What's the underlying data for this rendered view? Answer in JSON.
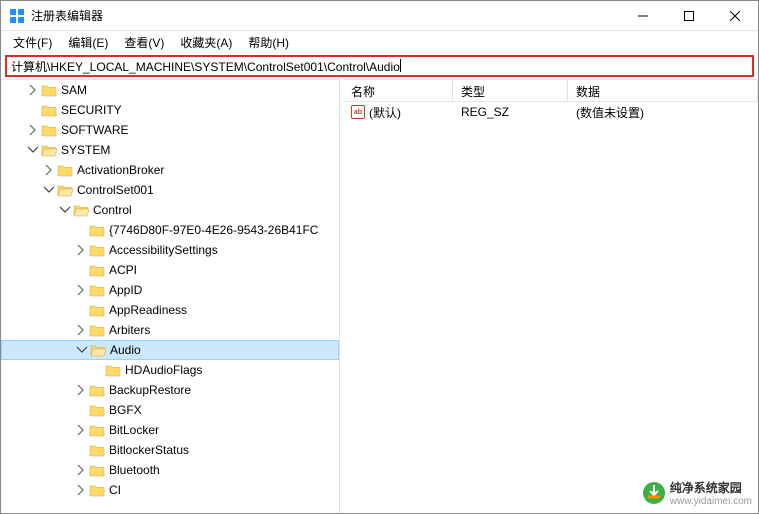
{
  "window": {
    "title": "注册表编辑器"
  },
  "menubar": {
    "file": "文件(F)",
    "edit": "编辑(E)",
    "view": "查看(V)",
    "favorites": "收藏夹(A)",
    "help": "帮助(H)"
  },
  "addressbar": {
    "path": "计算机\\HKEY_LOCAL_MACHINE\\SYSTEM\\ControlSet001\\Control\\Audio"
  },
  "tree": {
    "items": [
      {
        "depth": 1,
        "exp": "closed",
        "label": "SAM"
      },
      {
        "depth": 1,
        "exp": "none",
        "label": "SECURITY"
      },
      {
        "depth": 1,
        "exp": "closed",
        "label": "SOFTWARE"
      },
      {
        "depth": 1,
        "exp": "open",
        "label": "SYSTEM"
      },
      {
        "depth": 2,
        "exp": "closed",
        "label": "ActivationBroker"
      },
      {
        "depth": 2,
        "exp": "open",
        "label": "ControlSet001"
      },
      {
        "depth": 3,
        "exp": "open",
        "label": "Control"
      },
      {
        "depth": 4,
        "exp": "none",
        "label": "{7746D80F-97E0-4E26-9543-26B41FC"
      },
      {
        "depth": 4,
        "exp": "closed",
        "label": "AccessibilitySettings"
      },
      {
        "depth": 4,
        "exp": "none",
        "label": "ACPI"
      },
      {
        "depth": 4,
        "exp": "closed",
        "label": "AppID"
      },
      {
        "depth": 4,
        "exp": "none",
        "label": "AppReadiness"
      },
      {
        "depth": 4,
        "exp": "closed",
        "label": "Arbiters"
      },
      {
        "depth": 4,
        "exp": "open",
        "label": "Audio",
        "selected": true
      },
      {
        "depth": 5,
        "exp": "none",
        "label": "HDAudioFlags"
      },
      {
        "depth": 4,
        "exp": "closed",
        "label": "BackupRestore"
      },
      {
        "depth": 4,
        "exp": "none",
        "label": "BGFX"
      },
      {
        "depth": 4,
        "exp": "closed",
        "label": "BitLocker"
      },
      {
        "depth": 4,
        "exp": "none",
        "label": "BitlockerStatus"
      },
      {
        "depth": 4,
        "exp": "closed",
        "label": "Bluetooth"
      },
      {
        "depth": 4,
        "exp": "closed",
        "label": "CI"
      }
    ]
  },
  "list": {
    "headers": {
      "name": "名称",
      "type": "类型",
      "data": "数据"
    },
    "rows": [
      {
        "name": "(默认)",
        "type": "REG_SZ",
        "data": "(数值未设置)"
      }
    ]
  },
  "watermark": {
    "line1": "纯净系统家园",
    "line2": "www.yidaimei.com"
  }
}
